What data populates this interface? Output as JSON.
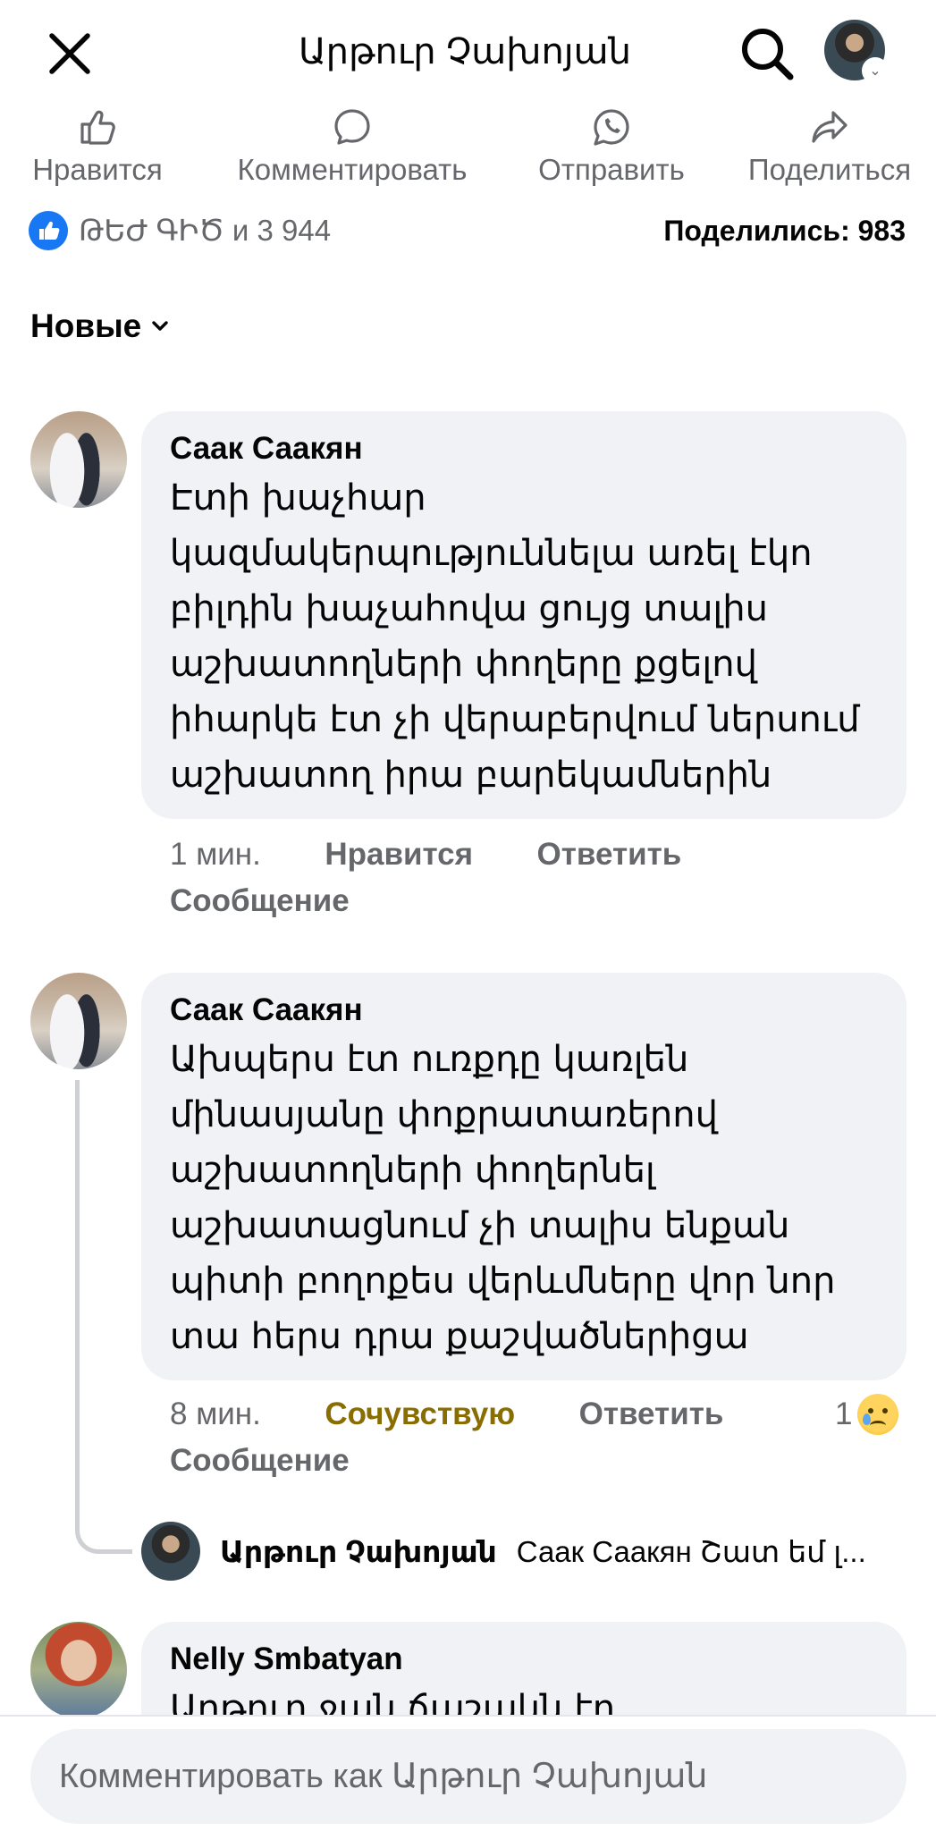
{
  "header": {
    "title": "Արթուր Չախոյան"
  },
  "actions": {
    "like": "Нравится",
    "comment": "Комментировать",
    "send": "Отправить",
    "share": "Поделиться"
  },
  "reactions": {
    "names": "ԹԵԺ ԳԻԾ и 3 944",
    "shares": "Поделились: 983"
  },
  "sort": {
    "label": "Новые"
  },
  "comments": [
    {
      "author": "Саак Саакян",
      "lines": [
        "Էտի խաչհար",
        "կազմակերպություննելա առել էկո",
        "բիլդին խաչահովա ցույց տալիս",
        "աշխատողների փողերը քցելով",
        "իհարկե էտ չի վերաբերվում ներսում",
        "աշխատող իրա բարեկամներին"
      ],
      "time": "1 мин.",
      "like": "Нравится",
      "reply": "Ответить",
      "message": "Сообщение"
    },
    {
      "author": "Саак Саакян",
      "lines": [
        "Ախպերս էտ ուռքդը կառլեն",
        "մինասյանը փոքրատառերով",
        "աշխատողների փողերնել",
        "աշխատացնում չի տալիս ենքան",
        "պիտի բողոքես վերևմները վոր նոր",
        "տա հերս դրա քաշվածներիցա"
      ],
      "time": "8 мин.",
      "reaction_label": "Сочувствую",
      "reply": "Ответить",
      "message": "Сообщение",
      "reaction_count": "1"
    },
    {
      "author": "Nelly Smbatyan",
      "lines": [
        "Արթուր ջան ճաշակն էր"
      ]
    }
  ],
  "reply_preview": {
    "author": "Արթուր Չախոյան",
    "text": "Саак Саакян Շատ եմ լ..."
  },
  "composer": {
    "placeholder": "Комментировать как Արթուր Չախոյան"
  },
  "colors": {
    "accent": "#1877f2",
    "bubble": "#f0f2f5",
    "secondary_text": "#65676b",
    "sad_reaction": "#8a6d00"
  }
}
